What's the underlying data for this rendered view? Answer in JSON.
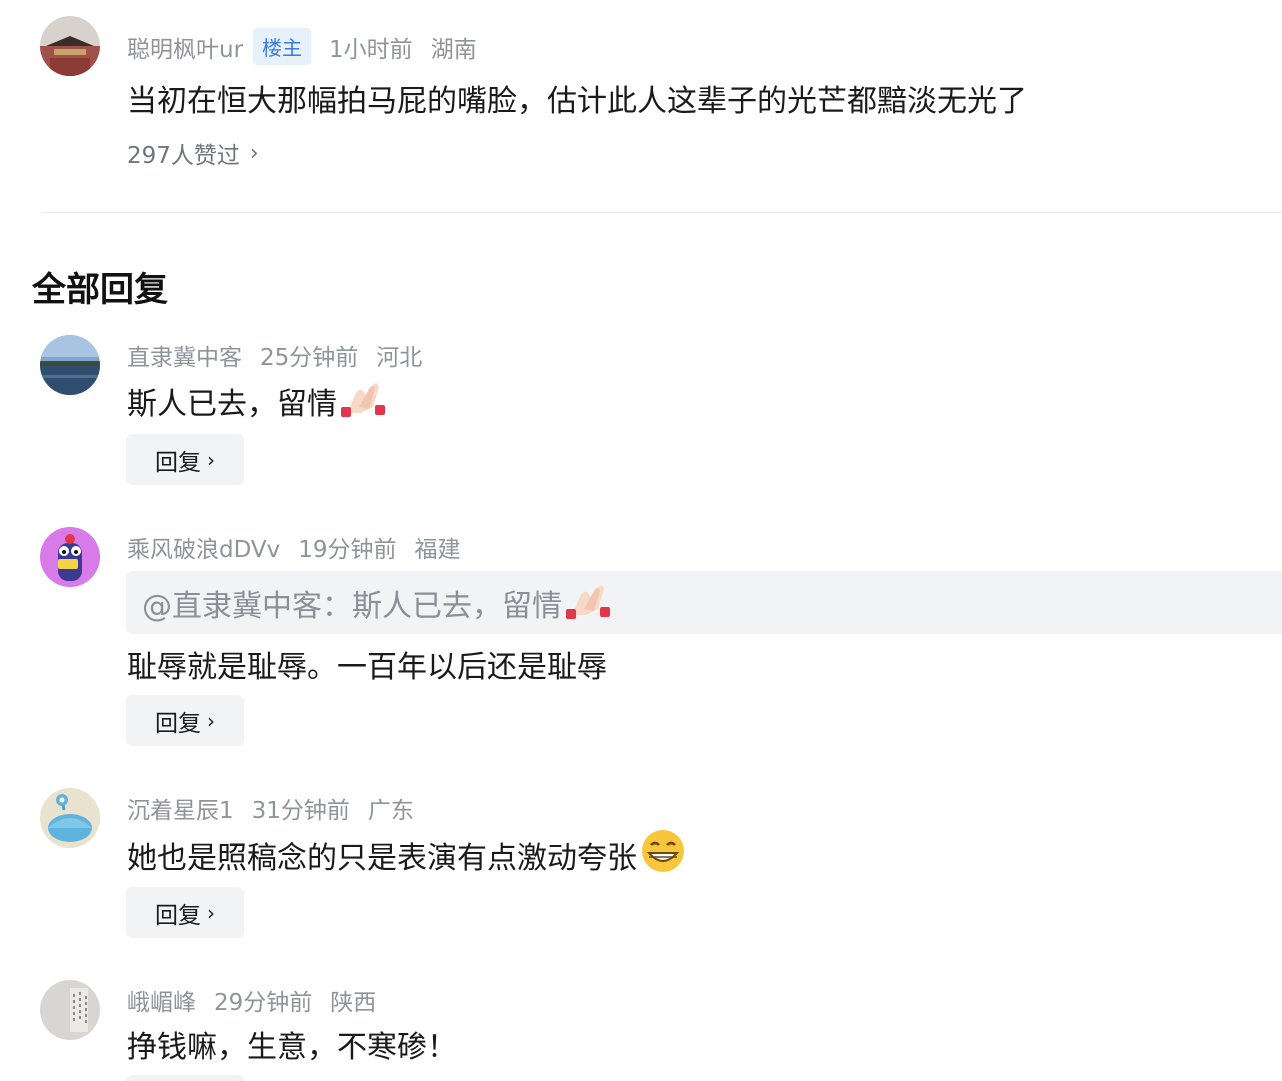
{
  "main_comment": {
    "username": "聪明枫叶ur",
    "badge": "楼主",
    "time": "1小时前",
    "location": "湖南",
    "text": "当初在恒大那幅拍马屁的嘴脸，估计此人这辈子的光芒都黯淡无光了",
    "likes": "297人赞过",
    "likes_chevron": "›"
  },
  "section_title": "全部回复",
  "replies": [
    {
      "username": "直隶冀中客",
      "time": "25分钟前",
      "location": "河北",
      "text": "斯人已去，留情",
      "emoji": "pray-hands-emoji",
      "reply_label": "回复",
      "reply_chevron": "›"
    },
    {
      "username": "乘风破浪dDVv",
      "time": "19分钟前",
      "location": "福建",
      "quote": "@直隶冀中客：斯人已去，留情",
      "quote_emoji": "pray-hands-emoji",
      "text": "耻辱就是耻辱。一百年以后还是耻辱",
      "reply_label": "回复",
      "reply_chevron": "›"
    },
    {
      "username": "沉着星辰1",
      "time": "31分钟前",
      "location": "广东",
      "text": "她也是照稿念的只是表演有点激动夸张",
      "emoji": "grinning-face-emoji",
      "reply_label": "回复",
      "reply_chevron": "›"
    },
    {
      "username": "峨嵋峰",
      "time": "29分钟前",
      "location": "陕西",
      "text": "挣钱嘛，生意，不寒碜！"
    }
  ],
  "colors": {
    "meta_text": "#8f949b",
    "badge_bg": "#e7f1fc",
    "badge_text": "#3a7be0",
    "reply_bg": "#f2f3f5"
  }
}
